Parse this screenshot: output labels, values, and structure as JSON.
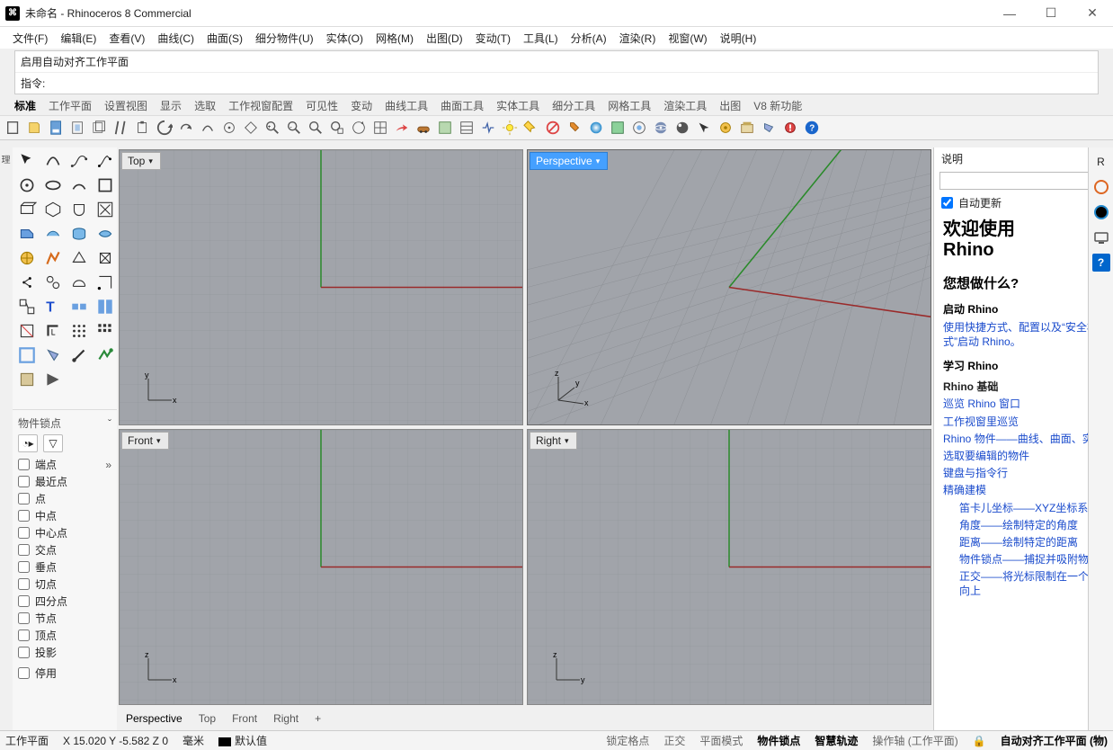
{
  "titlebar": {
    "title": "未命名 - Rhinoceros 8 Commercial",
    "icon_char": "⌘"
  },
  "menubar": [
    "文件(F)",
    "编辑(E)",
    "查看(V)",
    "曲线(C)",
    "曲面(S)",
    "细分物件(U)",
    "实体(O)",
    "网格(M)",
    "出图(D)",
    "变动(T)",
    "工具(L)",
    "分析(A)",
    "渲染(R)",
    "视窗(W)",
    "说明(H)"
  ],
  "cmd": {
    "history": "启用自动对齐工作平面",
    "prompt_label": "指令:"
  },
  "tabs": [
    "标准",
    "工作平面",
    "设置视图",
    "显示",
    "选取",
    "工作视窗配置",
    "可见性",
    "变动",
    "曲线工具",
    "曲面工具",
    "实体工具",
    "细分工具",
    "网格工具",
    "渲染工具",
    "出图",
    "V8 新功能"
  ],
  "tabs_active_index": 0,
  "viewports": {
    "labels": [
      "Top",
      "Perspective",
      "Front",
      "Right"
    ],
    "active_index": 1,
    "tabs": [
      "Perspective",
      "Top",
      "Front",
      "Right",
      "+"
    ],
    "tabs_active_index": 0,
    "axes": {
      "top": "x,y",
      "perspective": "x,y,z",
      "front": "x,z",
      "right": "y,z"
    }
  },
  "osnap": {
    "title": "物件锁点",
    "items": [
      "端点",
      "最近点",
      "点",
      "中点",
      "中心点",
      "交点",
      "垂点",
      "切点",
      "四分点",
      "节点",
      "顶点",
      "投影"
    ],
    "disable": "停用"
  },
  "right_panel": {
    "title": "说明",
    "auto_update": "自动更新",
    "welcome_h1_a": "欢迎使用",
    "welcome_h1_b": "Rhino",
    "q": "您想做什么?",
    "sec1_title": "启动 Rhino",
    "sec1_link": "使用快捷方式、配置以及“安全模式”启动 Rhino。",
    "sec2_title": "学习 Rhino",
    "sec2_sub": "Rhino 基础",
    "links": [
      "巡览 Rhino 窗口",
      "工作视窗里巡览",
      "Rhino 物件——曲线、曲面、实体",
      "选取要编辑的物件",
      "键盘与指令行",
      "精确建模"
    ],
    "sub_links": [
      "笛卡儿坐标——XYZ坐标系",
      "角度——绘制特定的角度",
      "距离——绘制特定的距离",
      "物件锁点——捕捉并吸附物件",
      "正交——将光标限制在一个方向上"
    ]
  },
  "status": {
    "cplane": "工作平面",
    "coords": "X 15.020 Y -5.582 Z 0",
    "units": "毫米",
    "layer": "默认值",
    "grid_snap": "锁定格点",
    "ortho": "正交",
    "planar": "平面模式",
    "osnap": "物件锁点",
    "smart": "智慧轨迹",
    "gumball": "操作轴 (工作平面)",
    "auto_cplane": "自动对齐工作平面 (物)"
  }
}
